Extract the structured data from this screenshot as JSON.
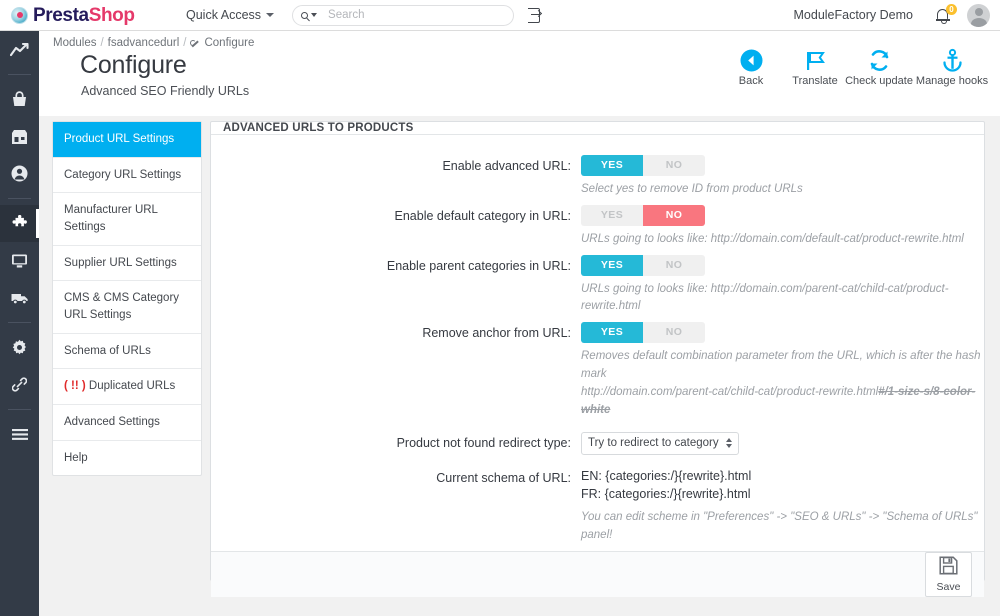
{
  "header": {
    "logo_presta": "Presta",
    "logo_shop": "Shop",
    "quick_access": "Quick Access",
    "search_placeholder": "Search",
    "user_name": "ModuleFactory Demo",
    "notification_count": "0"
  },
  "breadcrumb": {
    "item1": "Modules",
    "item2": "fsadvancedurl",
    "item3": "Configure",
    "sep": "/"
  },
  "page": {
    "title": "Configure",
    "subtitle": "Advanced SEO Friendly URLs"
  },
  "toolbar": [
    {
      "label": "Back",
      "icon": "back-arrow-icon"
    },
    {
      "label": "Translate",
      "icon": "flag-icon"
    },
    {
      "label": "Check update",
      "icon": "refresh-icon"
    },
    {
      "label": "Manage hooks",
      "icon": "anchor-icon"
    }
  ],
  "rail": [
    {
      "name": "dashboard",
      "icon": "trend-arrow-icon"
    },
    {
      "name": "orders",
      "icon": "basket-icon"
    },
    {
      "name": "catalog",
      "icon": "store-icon"
    },
    {
      "name": "customers",
      "icon": "person-circle-icon"
    },
    {
      "name": "modules",
      "icon": "puzzle-icon"
    },
    {
      "name": "design",
      "icon": "monitor-icon"
    },
    {
      "name": "shipping",
      "icon": "truck-icon"
    },
    {
      "name": "configure",
      "icon": "gear-icon"
    },
    {
      "name": "advanced-parameters",
      "icon": "link-icon"
    },
    {
      "name": "more-menu",
      "icon": "hamburger-icon"
    }
  ],
  "side_nav": [
    {
      "label": "Product URL Settings",
      "active": true
    },
    {
      "label": "Category URL Settings",
      "active": false
    },
    {
      "label": "Manufacturer URL Settings",
      "active": false
    },
    {
      "label": "Supplier URL Settings",
      "active": false
    },
    {
      "label": "CMS & CMS Category URL Settings",
      "active": false
    },
    {
      "label": "Schema of URLs",
      "active": false
    },
    {
      "label": "Duplicated URLs",
      "active": false,
      "warning": "( !! )"
    },
    {
      "label": "Advanced Settings",
      "active": false
    },
    {
      "label": "Help",
      "active": false
    }
  ],
  "panel": {
    "title": "ADVANCED URLS TO PRODUCTS",
    "yes_label": "YES",
    "no_label": "NO",
    "rows": [
      {
        "label": "Enable advanced URL:",
        "value": "yes",
        "hint": "Select yes to remove ID from product URLs"
      },
      {
        "label": "Enable default category in URL:",
        "value": "no",
        "hint": "URLs going to looks like: http://domain.com/default-cat/product-rewrite.html"
      },
      {
        "label": "Enable parent categories in URL:",
        "value": "yes",
        "hint": "URLs going to looks like: http://domain.com/parent-cat/child-cat/product-rewrite.html"
      },
      {
        "label": "Remove anchor from URL:",
        "value": "yes",
        "hint_line1": "Removes default combination parameter from the URL, which is after the hash mark",
        "hint_line2": "http://domain.com/parent-cat/child-cat/product-rewrite.html",
        "hint_strike": "#/1-size-s/8-color-white"
      }
    ],
    "redirect": {
      "label": "Product not found redirect type:",
      "selected": "Try to redirect to category (Recc"
    },
    "schema": {
      "label": "Current schema of URL:",
      "line_en": "EN: {categories:/}{rewrite}.html",
      "line_fr": "FR: {categories:/}{rewrite}.html",
      "hint": "You can edit scheme in \"Preferences\" -> \"SEO & URLs\" -> \"Schema of URLs\" panel!"
    },
    "save_label": "Save"
  },
  "colors": {
    "accent_cyan": "#00aff0",
    "toggle_on": "#25b9d7",
    "toggle_no": "#f9767f",
    "brand_pink": "#e5396a",
    "brand_navy": "#251b5b",
    "rail_bg": "#333b47"
  }
}
